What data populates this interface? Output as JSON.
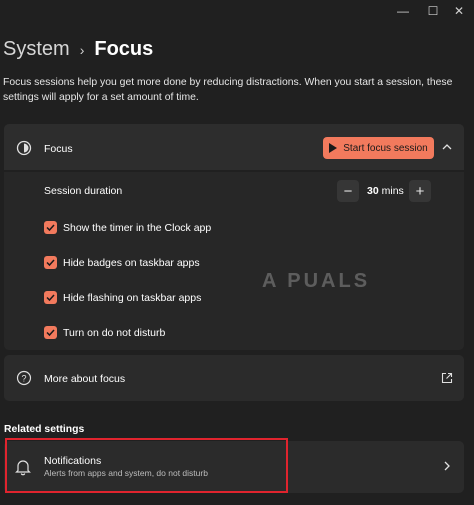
{
  "window": {
    "minimize": "—",
    "maximize": "☐",
    "close": "✕"
  },
  "breadcrumb": {
    "parent": "System",
    "separator": "›",
    "current": "Focus"
  },
  "description": "Focus sessions help you get more done by reducing distractions. When you start a session, these settings will apply for a set amount of time.",
  "focus": {
    "label": "Focus",
    "start_button": "Start focus session",
    "duration": {
      "label": "Session duration",
      "value": "30",
      "unit": "mins",
      "minus": "−",
      "plus": "+"
    },
    "options": [
      {
        "label": "Show the timer in the Clock app",
        "checked": true
      },
      {
        "label": "Hide badges on taskbar apps",
        "checked": true
      },
      {
        "label": "Hide flashing on taskbar apps",
        "checked": true
      },
      {
        "label": "Turn on do not disturb",
        "checked": true
      }
    ]
  },
  "more_about": {
    "label": "More about focus"
  },
  "related": {
    "heading": "Related settings",
    "notifications": {
      "title": "Notifications",
      "subtitle": "Alerts from apps and system, do not disturb"
    }
  },
  "watermark": "A PUALS",
  "colors": {
    "accent": "#f27a5d",
    "highlight": "#e0242e",
    "background": "#202020"
  }
}
